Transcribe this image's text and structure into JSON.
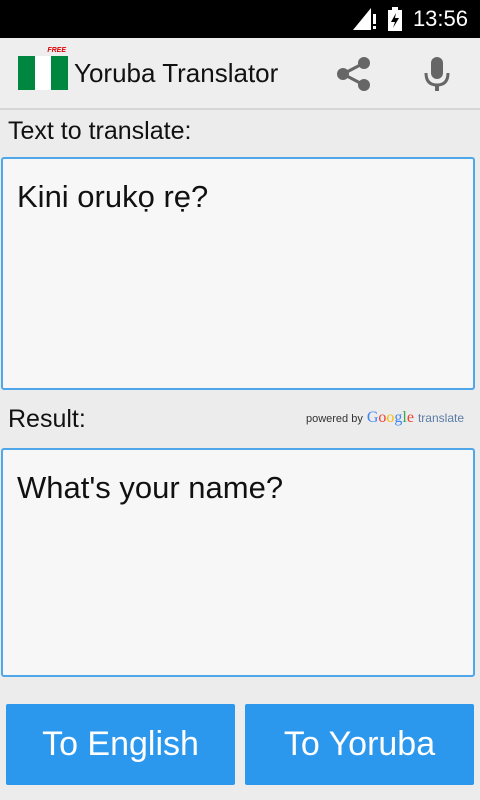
{
  "status_bar": {
    "time": "13:56"
  },
  "app_bar": {
    "title": "Yoruba Translator",
    "flag_badge": "FREE",
    "flag_colors": [
      "#00873f",
      "#ffffff",
      "#00873f"
    ],
    "actions": [
      "share-icon",
      "mic-icon"
    ]
  },
  "source": {
    "label": "Text to translate:",
    "text": "Kini orukọ rẹ?"
  },
  "result": {
    "label": "Result:",
    "text": "What's your name?",
    "powered_by": "powered by",
    "brand": {
      "G": "G",
      "o1": "o",
      "o2": "o",
      "g": "g",
      "l": "l",
      "e": "e"
    },
    "brand_suffix": "translate"
  },
  "buttons": {
    "to_english": "To English",
    "to_yoruba": "To Yoruba"
  },
  "colors": {
    "accent": "#2b98ee",
    "border": "#4fa7ea"
  }
}
